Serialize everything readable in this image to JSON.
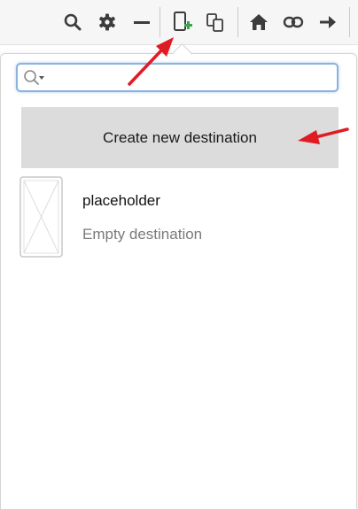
{
  "toolbar": {
    "items": [
      {
        "name": "search",
        "icon": "search-icon"
      },
      {
        "name": "settings",
        "icon": "gear-icon"
      },
      {
        "name": "collapse",
        "icon": "minus-icon"
      },
      {
        "name": "new-destination",
        "icon": "add-document-icon"
      },
      {
        "name": "copy",
        "icon": "copy-icon"
      },
      {
        "name": "home",
        "icon": "home-icon"
      },
      {
        "name": "link",
        "icon": "link-icon"
      },
      {
        "name": "next",
        "icon": "arrow-right-icon"
      }
    ]
  },
  "popup": {
    "search": {
      "value": "",
      "placeholder": ""
    },
    "create_label": "Create new destination",
    "destinations": [
      {
        "title": "placeholder",
        "subtitle": "Empty destination"
      }
    ]
  },
  "colors": {
    "accent_plus": "#3aa64b",
    "annotation_arrow": "#e11b22",
    "button_bg": "#dcdcdc",
    "search_border": "#8ab3e0"
  }
}
